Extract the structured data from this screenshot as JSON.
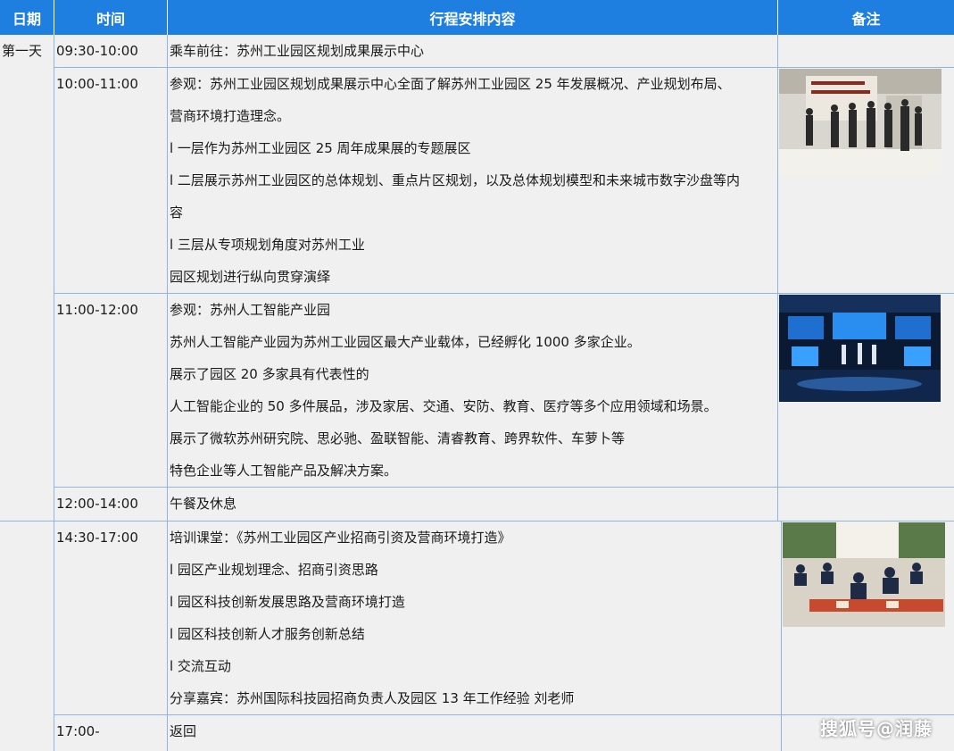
{
  "headers": {
    "date": "日期",
    "time": "时间",
    "content": "行程安排内容",
    "remark": "备注"
  },
  "day1": {
    "label": "第一天",
    "rows": [
      {
        "time": "09:30-10:00",
        "lines": [
          "乘车前往：苏州工业园区规划成果展示中心"
        ]
      },
      {
        "time": "10:00-11:00",
        "lines": [
          "参观：苏州工业园区规划成果展示中心全面了解苏州工业园区 25 年发展概况、产业规划布局、",
          "营商环境打造理念。",
          "l 一层作为苏州工业园区 25 周年成果展的专题展区",
          "l 二层展示苏州工业园区的总体规划、重点片区规划，以及总体规划模型和未来城市数字沙盘等内",
          "容",
          "l 三层从专项规划角度对苏州工业",
          "园区规划进行纵向贯穿演绎"
        ],
        "photo": "exhibition-hall-photo"
      },
      {
        "time": "11:00-12:00",
        "lines": [
          "参观：苏州人工智能产业园",
          "苏州人工智能产业园为苏州工业园区最大产业载体，已经孵化 1000 多家企业。",
          "展示了园区 20 多家具有代表性的",
          "人工智能企业的 50 多件展品，涉及家居、交通、安防、教育、医疗等多个应用领域和场景。",
          "展示了微软苏州研究院、思必驰、盈联智能、清睿教育、跨界软件、车萝卜等",
          "特色企业等人工智能产品及解决方案。"
        ],
        "photo": "ai-park-photo"
      },
      {
        "time": "12:00-14:00",
        "lines": [
          "午餐及休息"
        ]
      }
    ]
  },
  "day2": {
    "label": "",
    "rows": [
      {
        "time": "14:30-17:00",
        "lines": [
          "培训课堂：《苏州工业园区产业招商引资及营商环境打造》",
          "l 园区产业规划理念、招商引资思路",
          "l 园区科技创新发展思路及营商环境打造",
          "l 园区科技创新人才服务创新总结",
          "l 交流互动",
          "分享嘉宾：苏州国际科技园招商负责人及园区 13 年工作经验 刘老师"
        ],
        "photo": "classroom-photo"
      },
      {
        "time": "17:00-",
        "lines": [
          "返回"
        ]
      }
    ]
  },
  "watermark": "搜狐号@润藤"
}
